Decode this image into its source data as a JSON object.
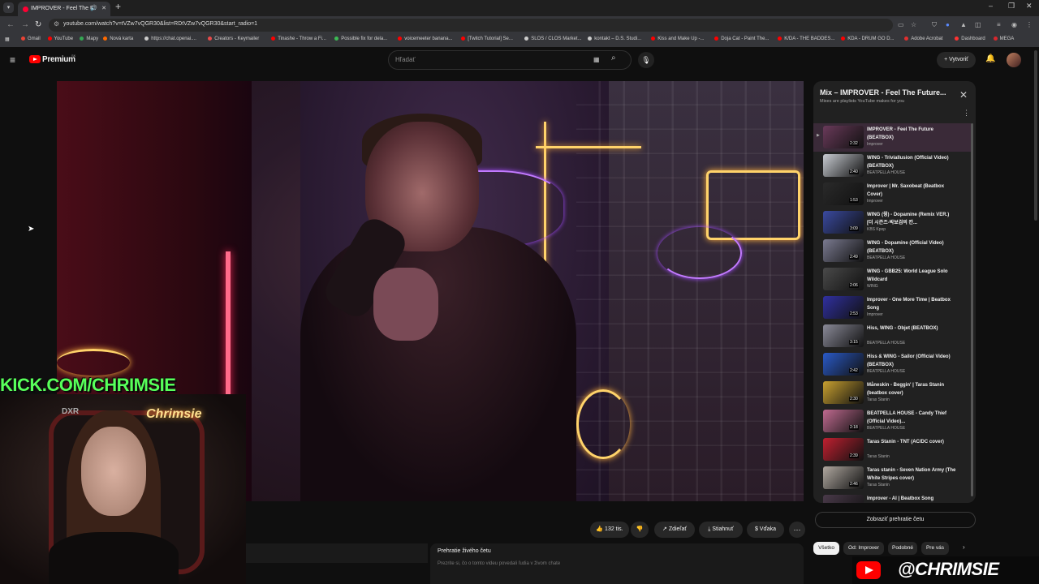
{
  "browser": {
    "tab_title": "IMPROVER - Feel The Future",
    "url": "youtube.com/watch?v=tVZw7vQGR30&list=RDtVZw7vQGR30&start_radio=1",
    "bookmarks": [
      {
        "label": "Gmail",
        "color": "#ea4335"
      },
      {
        "label": "YouTube",
        "color": "#ff0000"
      },
      {
        "label": "Mapy",
        "color": "#34a853"
      },
      {
        "label": "Nová karta",
        "color": "#ff6a00"
      },
      {
        "label": "https://chat.openai....",
        "color": "#cccccc"
      },
      {
        "label": "Creators - Keymailer",
        "color": "#e84a4a"
      },
      {
        "label": "Tinashe - Throw a Fi...",
        "color": "#ff0000"
      },
      {
        "label": "Possible fix for dela...",
        "color": "#3cba54"
      },
      {
        "label": "voicemeeter banana...",
        "color": "#ff0000"
      },
      {
        "label": "[Twitch Tutorial] Se...",
        "color": "#ff0000"
      },
      {
        "label": "SLOS / CLOS Market...",
        "color": "#cccccc"
      },
      {
        "label": "kontakt – D.S. Studi...",
        "color": "#cccccc"
      },
      {
        "label": "Kiss and Make Up -...",
        "color": "#ff0000"
      },
      {
        "label": "Doja Cat - Paint The...",
        "color": "#ff0000"
      },
      {
        "label": "K/DA - THE BADDES...",
        "color": "#ff0000"
      },
      {
        "label": "KDA - DRUM GO D...",
        "color": "#ff0000"
      },
      {
        "label": "Adobe Acrobat",
        "color": "#e02f2f"
      },
      {
        "label": "Dashboard",
        "color": "#ff3333"
      },
      {
        "label": "MEGA",
        "color": "#d9272e"
      }
    ]
  },
  "header": {
    "brand": "Premium",
    "region": "SK",
    "search_placeholder": "Hľadať",
    "create_label": "Vytvoriť"
  },
  "overlay": {
    "kick_text": "KICK.COM/CHRIMSIE",
    "cam_logo": "Chrimsie",
    "chair_brand": "DXR",
    "yt_handle": "@CHRIMSIE"
  },
  "actions": {
    "likes": "132 tis.",
    "share": "Zdieľať",
    "download": "Stiahnuť",
    "thanks": "Vďaka"
  },
  "livechat": {
    "title": "Prehratie živého četu",
    "subtitle": "Prezrite si, čo o tomto videu povedali ľudia v živom chate"
  },
  "playlist": {
    "title": "Mix – IMPROVER - Feel The Future...",
    "subtitle": "Mixes are playlists YouTube makes for you",
    "items": [
      {
        "title": "IMPROVER - Feel The Future (BEATBOX)",
        "channel": "Improver",
        "duration": "2:32",
        "color": "#6a3a5a"
      },
      {
        "title": "WING - Triviallusion (Official Video) (BEATBOX)",
        "channel": "BEATPELLA HOUSE",
        "duration": "2:40",
        "color": "#c8ccd2"
      },
      {
        "title": "Improver | Mr. Saxobeat (Beatbox Cover)",
        "channel": "Improver",
        "duration": "1:53",
        "color": "#2a2a2a"
      },
      {
        "title": "WING (윙) - Dopamine (Remix VER.) [더 시즌즈-박보검의 칸...",
        "channel": "KBS Kpop",
        "duration": "3:09",
        "color": "#3a4aa0"
      },
      {
        "title": "WING - Dopamine (Official Video) (BEATBOX)",
        "channel": "BEATPELLA HOUSE",
        "duration": "2:49",
        "color": "#7a7a90"
      },
      {
        "title": "WING - GBB25: World League Solo Wildcard",
        "channel": "WING",
        "duration": "2:06",
        "color": "#4a4a4a"
      },
      {
        "title": "Improver - One More Time | Beatbox Song",
        "channel": "Improver",
        "duration": "2:53",
        "color": "#3030a0"
      },
      {
        "title": "Hiss, WING - Objet (BEATBOX)",
        "channel": "BEATPELLA HOUSE",
        "duration": "3:15",
        "color": "#8a8a98"
      },
      {
        "title": "Hiss & WING - Sailor (Official Video) (BEATBOX)",
        "channel": "BEATPELLA HOUSE",
        "duration": "2:42",
        "color": "#2a5ac8"
      },
      {
        "title": "Måneskin - Beggin' | Taras Stanin (beatbox cover)",
        "channel": "Taras Stanin",
        "duration": "2:30",
        "color": "#c8a030"
      },
      {
        "title": "BEATPELLA HOUSE - Candy Thief (Official Video)...",
        "channel": "BEATPELLA HOUSE",
        "duration": "2:18",
        "color": "#c06a90"
      },
      {
        "title": "Taras Stanin - TNT (AC/DC cover)",
        "channel": "Taras Stanin",
        "duration": "2:39",
        "color": "#c02030"
      },
      {
        "title": "Taras stanin - Seven Nation Army (The White Stripes cover)",
        "channel": "Taras Stanin",
        "duration": "2:46",
        "color": "#b0a8a0"
      },
      {
        "title": "Improver - AI | Beatbox Song",
        "channel": "",
        "duration": "",
        "color": "#4a3a4a"
      }
    ],
    "show_chat_label": "Zobraziť prehratie četu"
  },
  "chips": [
    {
      "label": "Všetko",
      "selected": true
    },
    {
      "label": "Od: Improver",
      "selected": false
    },
    {
      "label": "Podobné",
      "selected": false
    },
    {
      "label": "Pre vás",
      "selected": false
    }
  ]
}
